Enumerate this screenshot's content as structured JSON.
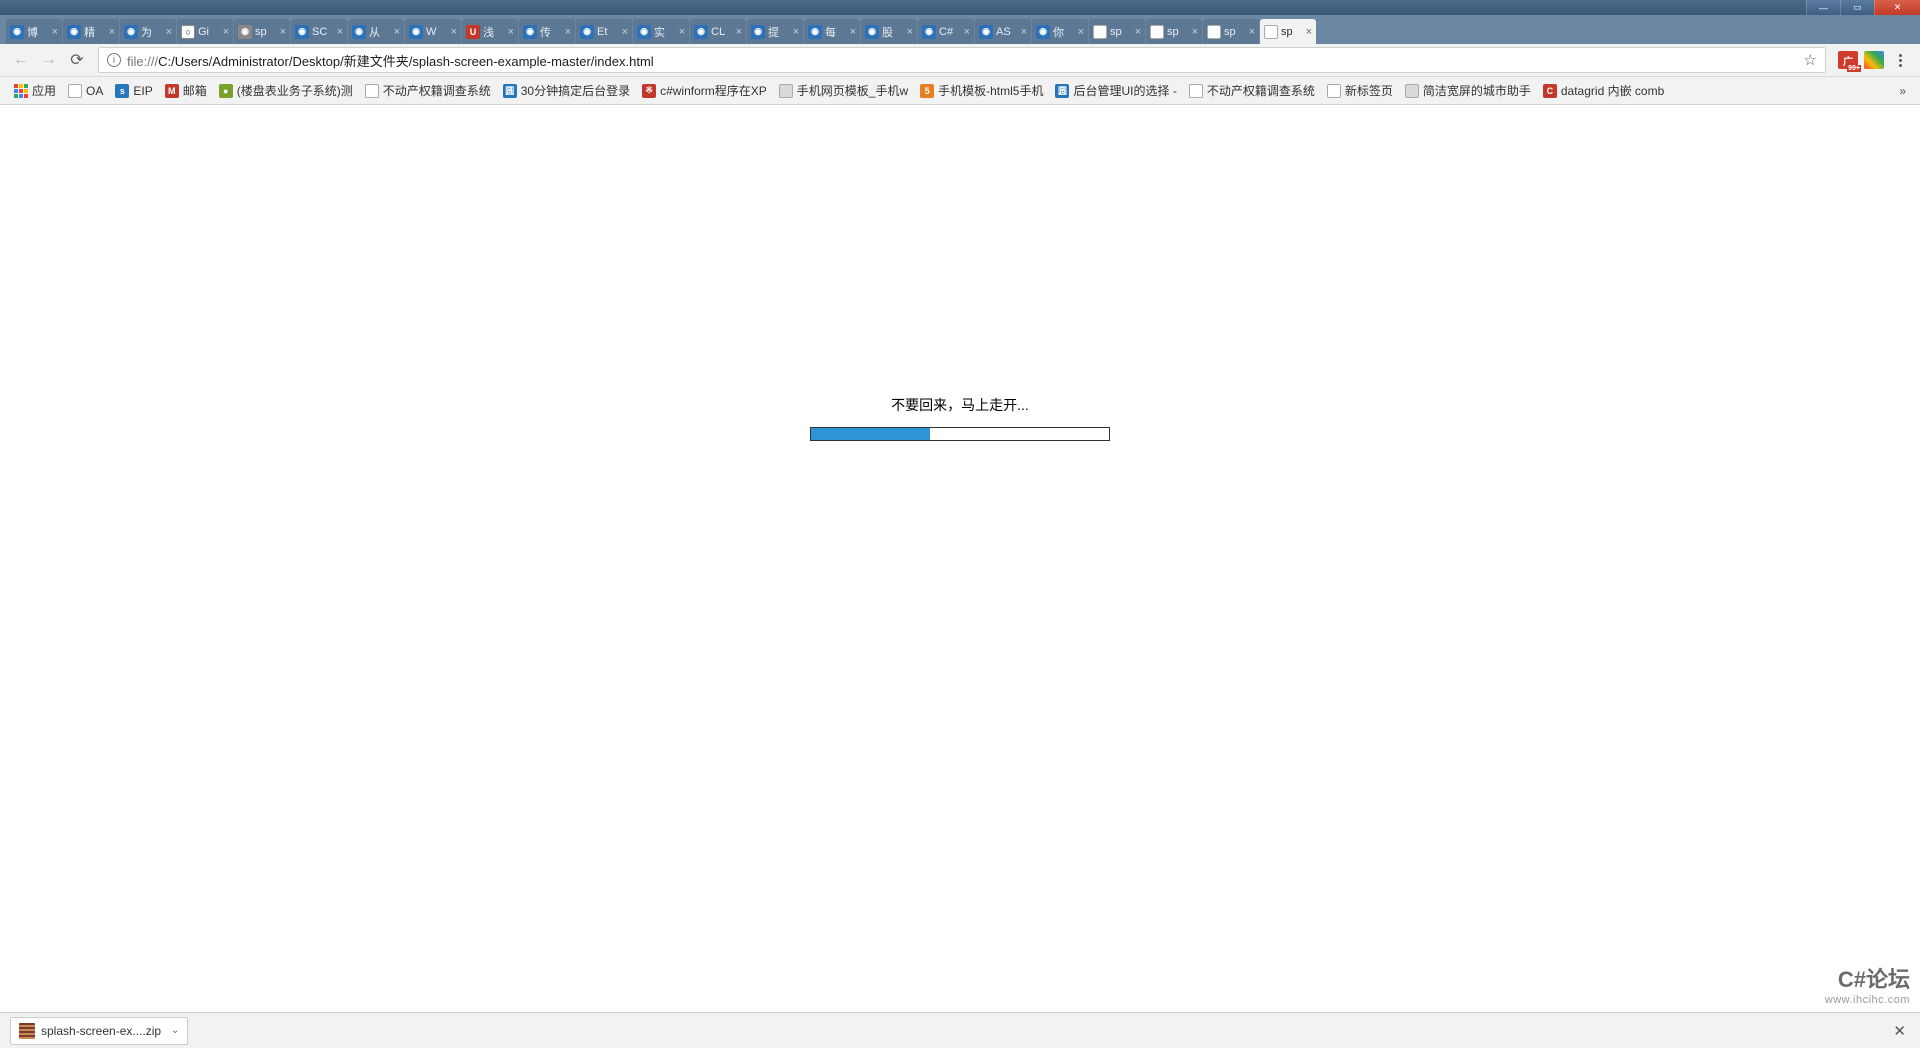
{
  "window_controls": {
    "minimize": "—",
    "maximize": "▭",
    "close": "✕"
  },
  "tabs": [
    {
      "label": "博",
      "fav": "fav-blue"
    },
    {
      "label": "精",
      "fav": "fav-blue"
    },
    {
      "label": "为",
      "fav": "fav-blue"
    },
    {
      "label": "Gi",
      "fav": "fav-gh"
    },
    {
      "label": "sp",
      "fav": "fav-grey"
    },
    {
      "label": "SC",
      "fav": "fav-blue"
    },
    {
      "label": "从",
      "fav": "fav-blue"
    },
    {
      "label": "W",
      "fav": "fav-blue"
    },
    {
      "label": "浅",
      "fav": "fav-red"
    },
    {
      "label": "传",
      "fav": "fav-blue"
    },
    {
      "label": "Et",
      "fav": "fav-blue"
    },
    {
      "label": "实",
      "fav": "fav-blue"
    },
    {
      "label": "CL",
      "fav": "fav-blue"
    },
    {
      "label": "提",
      "fav": "fav-blue"
    },
    {
      "label": "每",
      "fav": "fav-blue"
    },
    {
      "label": "股",
      "fav": "fav-blue"
    },
    {
      "label": "C#",
      "fav": "fav-blue"
    },
    {
      "label": "AS",
      "fav": "fav-blue"
    },
    {
      "label": "你",
      "fav": "fav-blue"
    },
    {
      "label": "sp",
      "fav": "fav-page"
    },
    {
      "label": "sp",
      "fav": "fav-page"
    },
    {
      "label": "sp",
      "fav": "fav-page"
    },
    {
      "label": "sp",
      "fav": "fav-page",
      "active": true
    }
  ],
  "address": {
    "protocol": "file:///",
    "path": "C:/Users/Administrator/Desktop/新建文件夹/splash-screen-example-master/index.html"
  },
  "bookmarks": {
    "apps_label": "应用",
    "items": [
      {
        "label": "OA",
        "icon": "i-page"
      },
      {
        "label": "EIP",
        "icon": "i-blue",
        "glyph": "s"
      },
      {
        "label": "邮箱",
        "icon": "i-red",
        "glyph": "M"
      },
      {
        "label": "(楼盘表业务子系统)测",
        "icon": "i-green",
        "glyph": "●"
      },
      {
        "label": "不动产权籍调查系统",
        "icon": "i-page"
      },
      {
        "label": "30分钟搞定后台登录",
        "icon": "i-blue",
        "glyph": "圆"
      },
      {
        "label": "c#winform程序在XP",
        "icon": "i-red",
        "glyph": "※"
      },
      {
        "label": "手机网页模板_手机w",
        "icon": "i-rbox"
      },
      {
        "label": "手机模板-html5手机",
        "icon": "i-orange",
        "glyph": "5"
      },
      {
        "label": "后台管理UI的选择 - ",
        "icon": "i-blue",
        "glyph": "圆"
      },
      {
        "label": "不动产权籍调查系统",
        "icon": "i-page"
      },
      {
        "label": "新标签页",
        "icon": "i-page"
      },
      {
        "label": "简洁宽屏的城市助手",
        "icon": "i-rbox"
      },
      {
        "label": "datagrid 内嵌 comb",
        "icon": "i-red",
        "glyph": "C"
      }
    ],
    "more": "»"
  },
  "page": {
    "loading_text": "不要回来，马上走开...",
    "progress_percent": 40
  },
  "downloads": {
    "filename": "splash-screen-ex....zip"
  },
  "watermark": {
    "line1": "C#论坛",
    "line2": "www.ihcihc.com"
  }
}
